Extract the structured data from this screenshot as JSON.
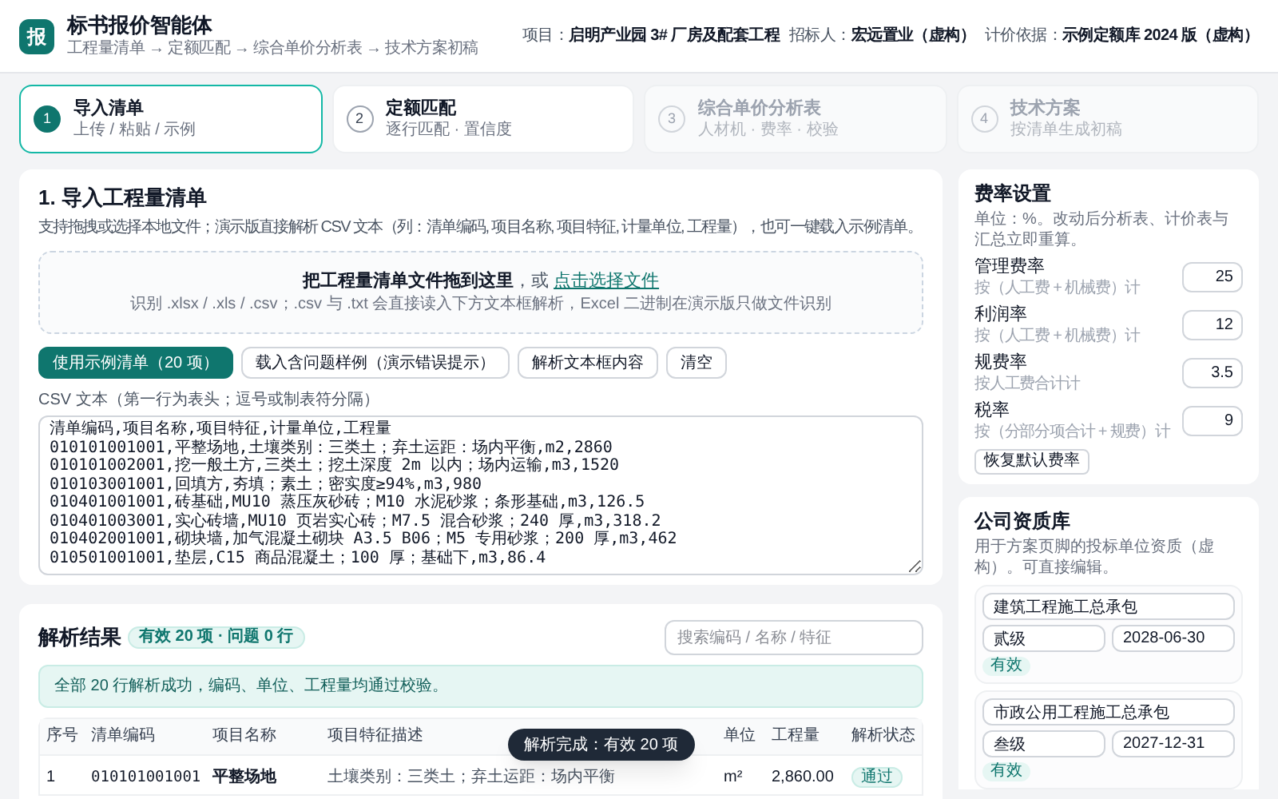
{
  "header": {
    "logo": "报",
    "title": "标书报价智能体",
    "breadcrumb": "工程量清单 → 定额匹配 → 综合单价分析表 → 技术方案初稿",
    "meta": [
      {
        "label": "项目：",
        "value": "启明产业园 3# 厂房及配套工程"
      },
      {
        "label": "招标人：",
        "value": "宏远置业（虚构）"
      },
      {
        "label": "计价依据：",
        "value": "示例定额库 2024 版（虚构）"
      }
    ]
  },
  "steps": [
    {
      "number": "1",
      "title": "导入清单",
      "subtitle": "上传 / 粘贴 / 示例",
      "selected": true,
      "disabled": false
    },
    {
      "number": "2",
      "title": "定额匹配",
      "subtitle": "逐行匹配 · 置信度",
      "selected": false,
      "disabled": false
    },
    {
      "number": "3",
      "title": "综合单价分析表",
      "subtitle": "人材机 · 费率 · 校验",
      "selected": false,
      "disabled": true
    },
    {
      "number": "4",
      "title": "技术方案",
      "subtitle": "按清单生成初稿",
      "selected": false,
      "disabled": true
    }
  ],
  "import": {
    "title": "1. 导入工程量清单",
    "description": "支持拖拽或选择本地文件；演示版直接解析 CSV 文本（列：清单编码, 项目名称, 项目特征, 计量单位, 工程量），也可一键载入示例清单。",
    "dropzone": {
      "text": "把工程量清单文件拖到这里",
      "or": "，或 ",
      "link": "点击选择文件",
      "hint": "识别 .xlsx / .xls / .csv；.csv 与 .txt 会直接读入下方文本框解析，Excel 二进制在演示版只做文件识别"
    },
    "buttons": [
      {
        "label": "使用示例清单（20 项）",
        "kind": "primary"
      },
      {
        "label": "载入含问题样例（演示错误提示）",
        "kind": "secondary"
      },
      {
        "label": "解析文本框内容",
        "kind": "secondary"
      },
      {
        "label": "清空",
        "kind": "secondary"
      }
    ],
    "csv_label": "CSV 文本（第一行为表头；逗号或制表符分隔）",
    "csv_lines": [
      "清单编码,项目名称,项目特征,计量单位,工程量",
      "010101001001,平整场地,土壤类别：三类土；弃土运距：场内平衡,m2,2860",
      "010101002001,挖一般土方,三类土；挖土深度 2m 以内；场内运输,m3,1520",
      "010103001001,回填方,夯填；素土；密实度≥94%,m3,980",
      "010401001001,砖基础,MU10 蒸压灰砂砖；M10 水泥砂浆；条形基础,m3,126.5",
      "010401003001,实心砖墙,MU10 页岩实心砖；M7.5 混合砂浆；240 厚,m3,318.2",
      "010402001001,砌块墙,加气混凝土砌块 A3.5 B06；M5 专用砂浆；200 厚,m3,462",
      "010501001001,垫层,C15 商品混凝土；100 厚；基础下,m3,86.4"
    ]
  },
  "results": {
    "title": "解析结果",
    "badge": "有效 20 项 · 问题 0 行",
    "search": {
      "placeholder": "搜索编码 / 名称 / 特征"
    },
    "alert": "全部 20 行解析成功，编码、单位、工程量均通过校验。",
    "table": {
      "columns": [
        "序号",
        "清单编码",
        "项目名称",
        "项目特征描述",
        "单位",
        "工程量",
        "解析状态"
      ],
      "rows": [
        {
          "index": "1",
          "code": "010101001001",
          "name": "平整场地",
          "features": "土壤类别：三类土；弃土运距：场内平衡",
          "unit": "m²",
          "quantity": "2,860.00",
          "status": "通过"
        }
      ]
    }
  },
  "toast": "解析完成：有效 20 项",
  "rates": {
    "title": "费率设置",
    "description": "单位：%。改动后分析表、计价表与汇总立即重算。",
    "items": [
      {
        "name": "管理费率",
        "hint": "按（人工费 + 机械费）计",
        "value": "25"
      },
      {
        "name": "利润率",
        "hint": "按（人工费 + 机械费）计",
        "value": "12"
      },
      {
        "name": "规费率",
        "hint": "按人工费合计计",
        "value": "3.5"
      },
      {
        "name": "税率",
        "hint": "按（分部分项合计 + 规费）计",
        "value": "9"
      }
    ],
    "reset": "恢复默认费率"
  },
  "qualifications": {
    "title": "公司资质库",
    "description": "用于方案页脚的投标单位资质（虚构）。可直接编辑。",
    "items": [
      {
        "name": "建筑工程施工总承包",
        "grade": "贰级",
        "expires": "2028-06-30",
        "status": "有效"
      },
      {
        "name": "市政公用工程施工总承包",
        "grade": "叁级",
        "expires": "2027-12-31",
        "status": "有效"
      }
    ]
  }
}
